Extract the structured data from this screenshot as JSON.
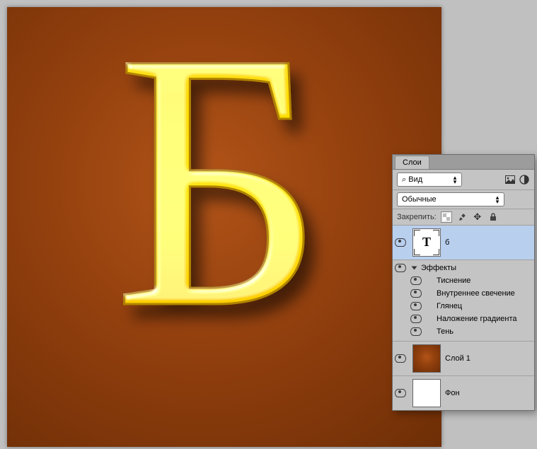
{
  "panel": {
    "tab": "Слои",
    "search_prefix": "⌕",
    "search_text": "Вид",
    "blend_mode": "Обычные",
    "lock_label": "Закрепить:"
  },
  "layers": {
    "text_layer_name": "б",
    "bg_layer1_name": "Слой 1",
    "bg_layer2_name": "Фон"
  },
  "fx": {
    "header": "Эффекты",
    "items": [
      "Тиснение",
      "Внутреннее свечение",
      "Глянец",
      "Наложение градиента",
      "Тень"
    ]
  },
  "glyph": "Б",
  "colors": {
    "gold1": "#fff566",
    "gold2": "#ffd900",
    "gold3": "#e6b800",
    "gold4": "#b38600"
  }
}
